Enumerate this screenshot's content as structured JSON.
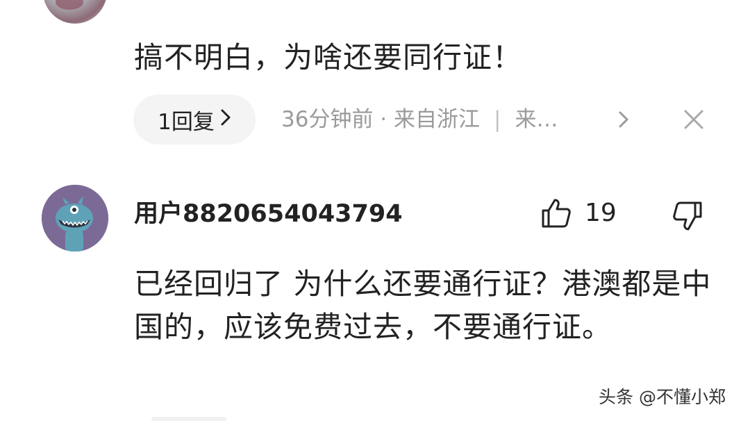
{
  "comment_1": {
    "text": "搞不明白，为啥还要同行证！",
    "reply_button_label": "1回复",
    "meta_time_location": "36分钟前 · 来自浙江",
    "meta_separator": "|",
    "meta_source": "来…"
  },
  "comment_2": {
    "username": "用户8820654043794",
    "like_count": "19",
    "text": "已经回归了 为什么还要通行证？港澳都是中国的，应该免费过去，不要通行证。"
  },
  "watermark": "头条 @不懂小郑",
  "colors": {
    "text": "#222222",
    "meta": "#9a9a9a",
    "pill_bg": "#f4f4f4",
    "avatar_bg": "#7c6a96",
    "avatar_monster": "#5fa2b8"
  },
  "icons": {
    "reply_chevron": "chevron-right-icon",
    "meta_more": "chevron-right-icon",
    "close": "close-icon",
    "like": "thumbs-up-icon",
    "dislike": "thumbs-down-icon"
  }
}
